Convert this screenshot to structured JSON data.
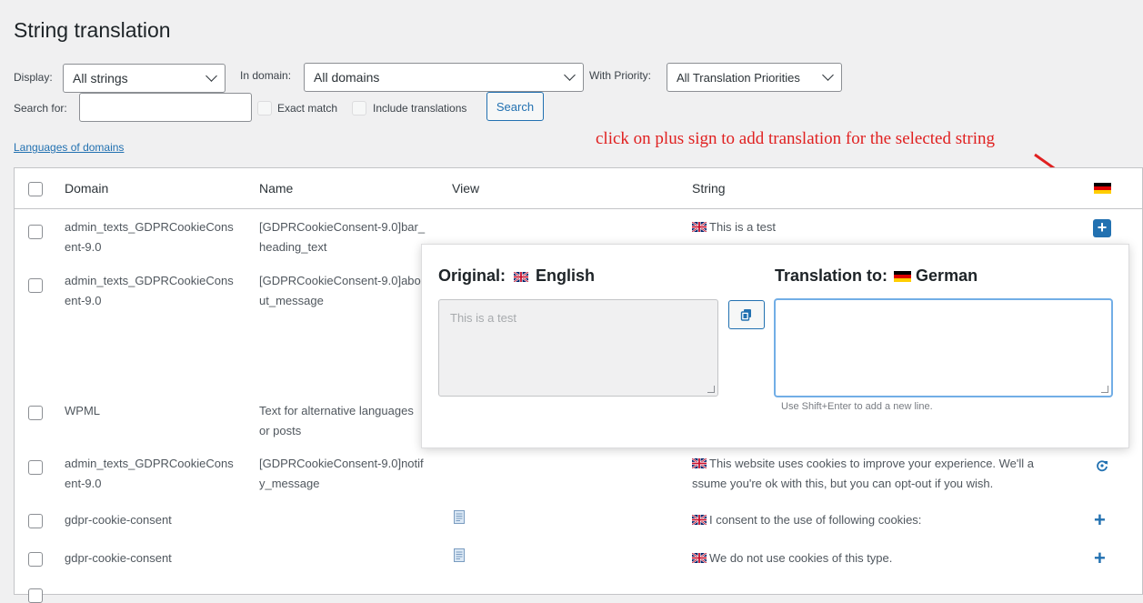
{
  "page": {
    "title": "String translation"
  },
  "filters": {
    "display_label": "Display:",
    "display_value": "All strings",
    "domain_label": "In domain:",
    "domain_value": "All domains",
    "priority_label": "With Priority:",
    "priority_value": "All Translation Priorities",
    "search_label": "Search for:",
    "search_value": "",
    "exact_match_label": "Exact match",
    "include_translations_label": "Include translations",
    "search_button": "Search"
  },
  "links": {
    "languages_of_domains": "Languages of domains"
  },
  "annotation": {
    "text": "click on plus sign to add translation for the selected string",
    "color": "#e02020"
  },
  "table": {
    "columns": {
      "domain": "Domain",
      "name": "Name",
      "view": "View",
      "string": "String"
    },
    "rows": [
      {
        "domain": "admin_texts_GDPRCookieCons\nent-9.0",
        "name": "[GDPRCookieConsent-9.0]bar_\nheading_text",
        "string": "This is a test",
        "action": "plus-box"
      },
      {
        "domain": "admin_texts_GDPRCookieCons\nent-9.0",
        "name": "[GDPRCookieConsent-9.0]abo\nut_message",
        "string": "",
        "action": ""
      },
      {
        "domain": "WPML",
        "name": "Text for alternative languages\nor posts",
        "string": "",
        "action": ""
      },
      {
        "domain": "admin_texts_GDPRCookieCons\nent-9.0",
        "name": "[GDPRCookieConsent-9.0]notif\ny_message",
        "string": "This website uses cookies to improve your experience. We'll a\nssume you're ok with this, but you can opt-out if you wish.",
        "action": "refresh"
      },
      {
        "domain": "gdpr-cookie-consent",
        "name": "",
        "string": "I consent to the use of following cookies:",
        "action": "plus"
      },
      {
        "domain": "gdpr-cookie-consent",
        "name": "",
        "string": "We do not use cookies of this type.",
        "action": "plus"
      }
    ]
  },
  "popup": {
    "original_label": "Original:",
    "original_language": "English",
    "translation_label": "Translation to:",
    "translation_language": "German",
    "original_text": "This is a test",
    "translation_value": "",
    "hint": "Use Shift+Enter to add a new line."
  },
  "colors": {
    "accent": "#2271b1",
    "focus": "#72aee6"
  }
}
